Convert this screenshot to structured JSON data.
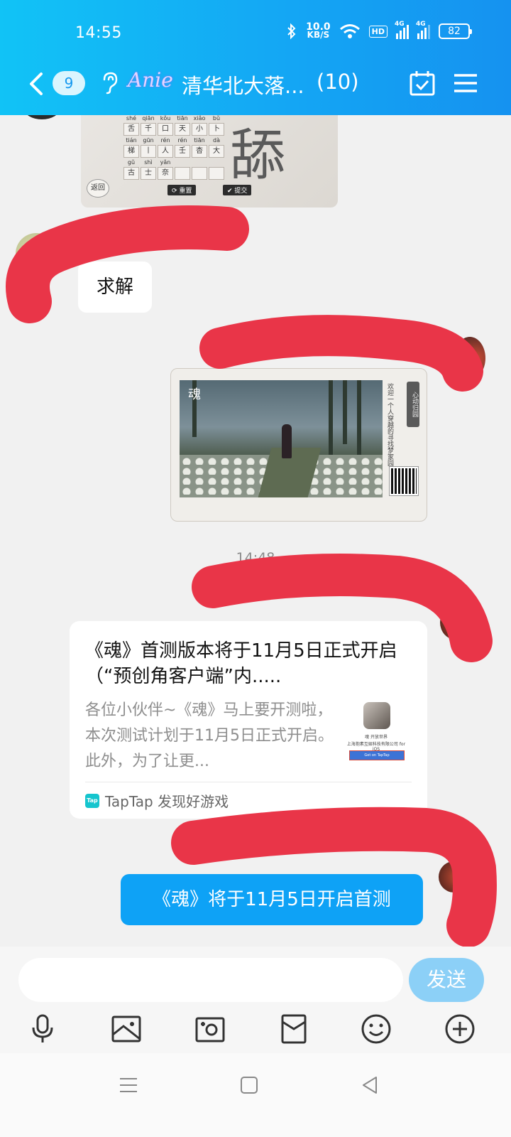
{
  "status_bar": {
    "time": "14:55",
    "net_speed_value": "10.0",
    "net_speed_unit": "KB/S",
    "hd_label": "HD",
    "signal1_label": "4G",
    "signal2_label": "4G",
    "battery": "82"
  },
  "header": {
    "unread_count": "9",
    "logo_text": "Anie",
    "title": "清华北大落...",
    "member_count": "(10)"
  },
  "messages": {
    "image1": {
      "pinyin": [
        "shé",
        "qiān",
        "kǒu",
        "tiān",
        "xiǎo",
        "bǔ",
        "tián",
        "gūn",
        "rén",
        "rén",
        "tiān",
        "dà",
        "gǔ",
        "shì",
        "yǎn",
        "",
        "",
        ""
      ],
      "chars": [
        "舌",
        "千",
        "口",
        "天",
        "小",
        "卜",
        "梯",
        "丨",
        "人",
        "壬",
        "杏",
        "大",
        "古",
        "士",
        "奈",
        "",
        "",
        ""
      ],
      "big_char": "舔",
      "reset_label": "重置",
      "submit_label": "提交",
      "back_label": "返回"
    },
    "text1": "求解",
    "image2": {
      "game_title": "魂",
      "side_text": "欢迎一个人穿越的寻找梦家园",
      "side_title": "心动归园"
    },
    "timestamp": "14:48",
    "link_card": {
      "title": "《魂》首测版本将于11月5日正式开启（“预创角客户端”内.....",
      "description": "各位小伙伴~《魂》马上要开测啦，本次测试计划于11月5日正式开启。此外，为了让更...",
      "thumb_line1": "魂 开放世界",
      "thumb_line2": "上海抱素互娱科技有限公司 for iOS",
      "thumb_button": "Get on TapTap",
      "source_icon": "Tap",
      "source": "TapTap 发现好游戏"
    },
    "text2": "《魂》将于11月5日开启首测"
  },
  "input": {
    "value": "",
    "placeholder": "",
    "send_label": "发送"
  },
  "toolbar_icons": [
    "microphone-icon",
    "image-icon",
    "camera-icon",
    "red-packet-icon",
    "emoji-icon",
    "plus-icon"
  ],
  "colors": {
    "header_start": "#11c3f6",
    "header_end": "#1592f0",
    "outgoing_bubble": "#0ea2f6",
    "send_button": "#8cd0f7",
    "redaction": "#e93548"
  }
}
